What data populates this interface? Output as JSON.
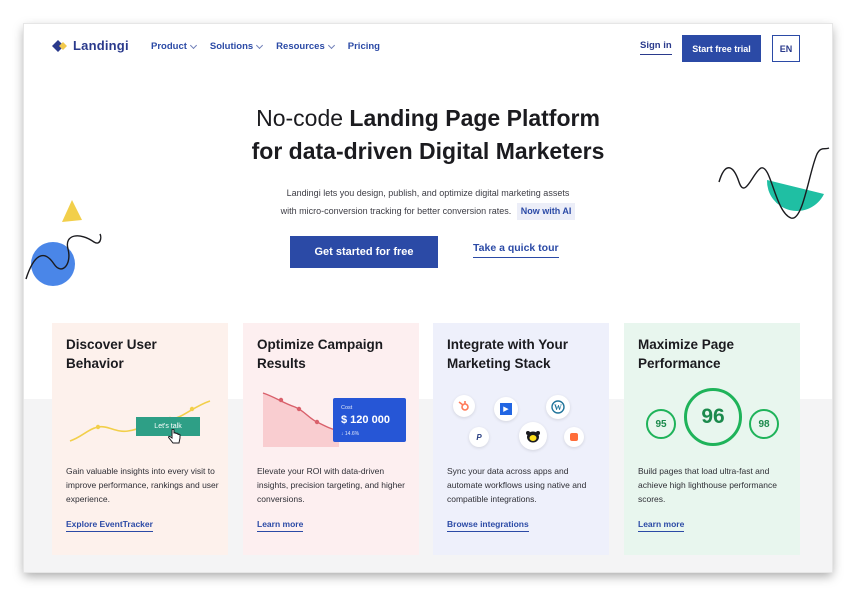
{
  "brand": {
    "name": "Landingi",
    "primary_color": "#2b4aa6",
    "logo_colors": [
      "#2a3a8c",
      "#f2c94c"
    ]
  },
  "nav": {
    "items": [
      {
        "label": "Product",
        "has_dropdown": true
      },
      {
        "label": "Solutions",
        "has_dropdown": true
      },
      {
        "label": "Resources",
        "has_dropdown": true
      },
      {
        "label": "Pricing",
        "has_dropdown": false
      }
    ],
    "sign_in": "Sign in",
    "trial_button": "Start free trial",
    "language": "EN"
  },
  "hero": {
    "title_regular": "No-code ",
    "title_bold_1": "Landing Page Platform",
    "title_bold_2": "for data-driven Digital Marketers",
    "subtitle_line_1": "Landingi lets you design, publish, and optimize digital marketing assets",
    "subtitle_line_2": "with micro-conversion tracking for better conversion rates.",
    "ai_badge": "Now with AI",
    "cta_primary": "Get started for free",
    "cta_secondary": "Take a quick tour"
  },
  "cards": [
    {
      "title": "Discover User Behavior",
      "description": "Gain valuable insights into every visit to improve performance, rankings and user experience.",
      "link": "Explore EventTracker",
      "illustration": {
        "button_label": "Let's talk",
        "icon": "hand-cursor-icon"
      },
      "background": "#fdf1ec"
    },
    {
      "title": "Optimize Campaign Results",
      "description": "Elevate your ROI with data-driven insights, precision targeting, and higher conversions.",
      "link": "Learn more",
      "illustration": {
        "cost_label": "Cost",
        "cost_value": "$ 120 000",
        "cost_change": "↓ 14.6%"
      },
      "background": "#fdeff0"
    },
    {
      "title": "Integrate with Your Marketing Stack",
      "description": "Sync your data across apps and automate workflows using native and compatible integrations.",
      "link": "Browse integrations",
      "illustration": {
        "icons": [
          "hubspot-icon",
          "dynamics-icon",
          "wordpress-icon",
          "paypal-icon",
          "mailchimp-icon",
          "zapier-icon"
        ]
      },
      "background": "#eef0fb"
    },
    {
      "title": "Maximize Page Performance",
      "description": "Build pages that load ultra-fast and achieve high lighthouse performance scores.",
      "link": "Learn more",
      "illustration": {
        "scores": [
          "95",
          "96",
          "98"
        ],
        "score_color": "#1fb35a"
      },
      "background": "#e8f6ee"
    }
  ]
}
